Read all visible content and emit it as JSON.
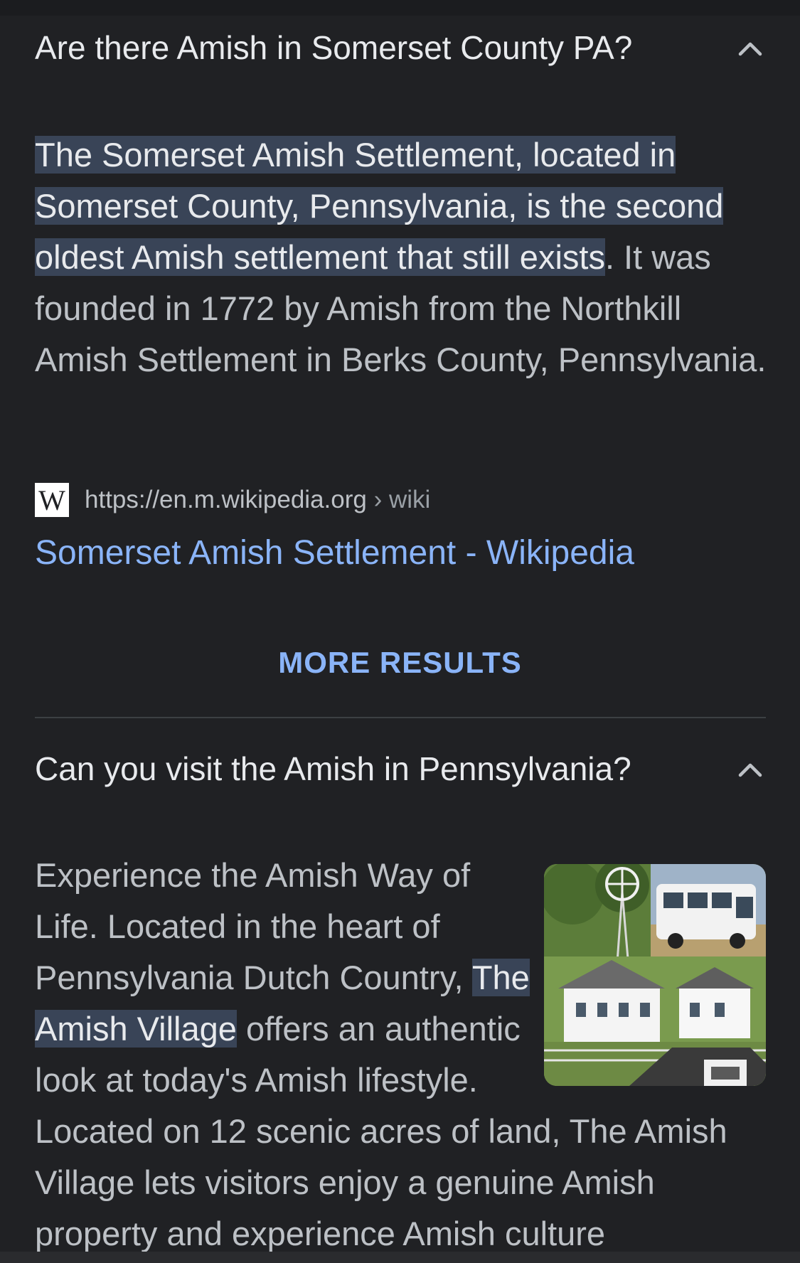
{
  "faq": [
    {
      "question": "Are there Amish in Somerset County PA?",
      "answer_highlight": "The Somerset Amish Settlement, located in Somerset County, Pennsylvania, is the second oldest Amish settlement that still exists",
      "answer_rest": ". It was founded in 1772 by Amish from the Northkill Amish Settlement in Berks County, Pennsylvania.",
      "source_logo": "W",
      "source_url": "https://en.m.wikipedia.org",
      "source_path": " › wiki",
      "source_title": "Somerset Amish Settlement - Wikipedia",
      "icon": "chevron-up-icon"
    },
    {
      "question": "Can you visit the Amish in Pennsylvania?",
      "answer_before": "Experience the Amish Way of Life. Located in the heart of Pennsylvania Dutch Country, ",
      "answer_highlight": "The Amish Village",
      "answer_after": " offers an authentic look at today's Amish lifestyle. Located on 12 scenic acres of land, The Amish Village lets visitors enjoy a genuine Amish property and experience Amish culture",
      "icon": "chevron-up-icon"
    }
  ],
  "more_results_label": "MORE RESULTS",
  "colors": {
    "background": "#202124",
    "link": "#8ab4f8",
    "highlight": "#394457"
  }
}
